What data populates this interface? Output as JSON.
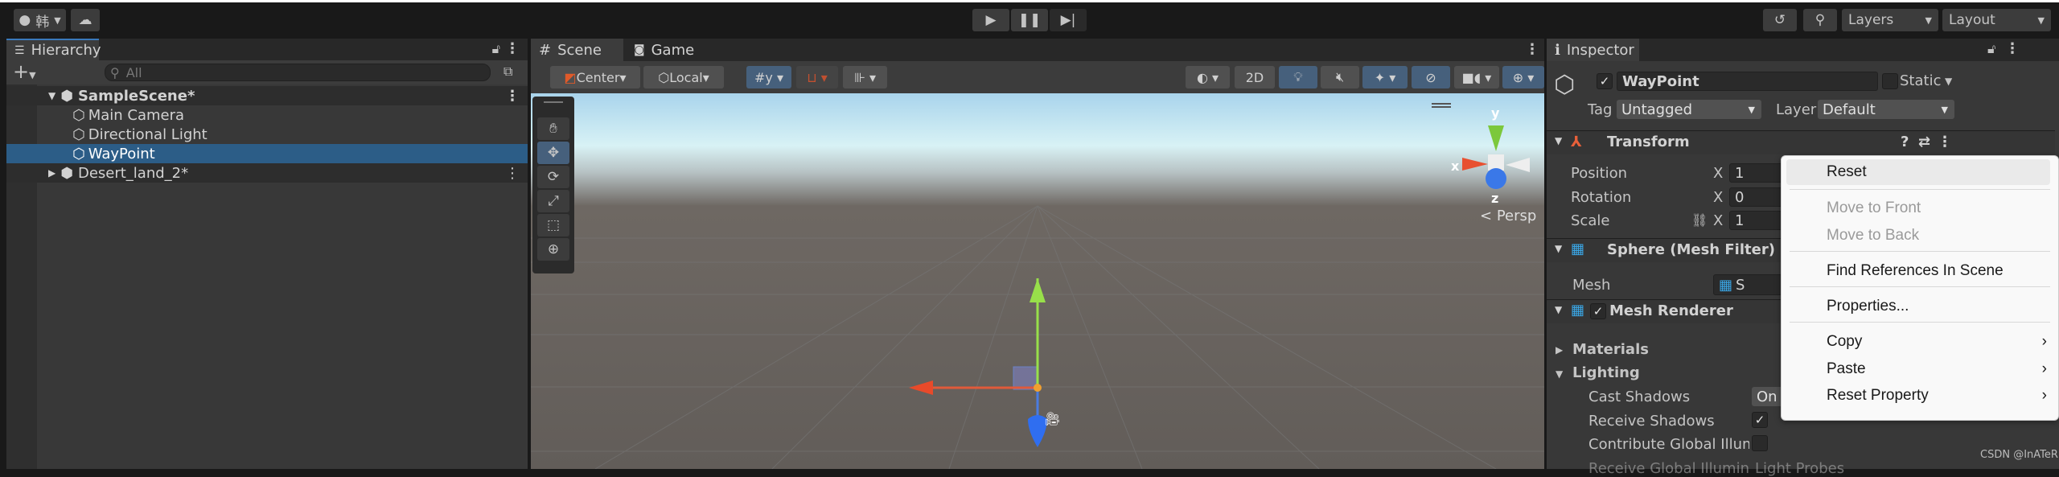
{
  "toolbar": {
    "account_label": "韩",
    "layers": "Layers",
    "layout": "Layout"
  },
  "hierarchy": {
    "tab": "Hierarchy",
    "search_placeholder": "All",
    "items": [
      {
        "label": "SampleScene*"
      },
      {
        "label": "Main Camera"
      },
      {
        "label": "Directional Light"
      },
      {
        "label": "WayPoint"
      },
      {
        "label": "Desert_land_2*"
      }
    ]
  },
  "scene": {
    "tabs": [
      {
        "label": "Scene"
      },
      {
        "label": "Game"
      }
    ],
    "pivot": "Center",
    "space": "Local",
    "mode_2d": "2D",
    "persp": "Persp",
    "gizmo_axes": {
      "x": "x",
      "y": "y",
      "z": "z"
    }
  },
  "inspector": {
    "tab": "Inspector",
    "name": "WayPoint",
    "static": "Static",
    "tag_label": "Tag",
    "tag": "Untagged",
    "layer_label": "Layer",
    "layer": "Default",
    "transform": {
      "title": "Transform",
      "position": "Position",
      "rotation": "Rotation",
      "scale": "Scale",
      "x": "X",
      "pos_x": "1",
      "rot_x": "0",
      "scale_x": "1"
    },
    "mesh_filter": {
      "title": "Sphere (Mesh Filter)",
      "mesh_label": "Mesh",
      "mesh_value": "S"
    },
    "mesh_renderer": {
      "title": "Mesh Renderer",
      "materials": "Materials",
      "lighting": "Lighting",
      "cast_shadows": "Cast Shadows",
      "cast_value": "On",
      "receive_shadows": "Receive Shadows",
      "contribute": "Contribute Global Illum",
      "receive_gi": "Receive Global Illumin",
      "receive_gi_value": "Light Probes"
    }
  },
  "context_menu": {
    "items": [
      {
        "label": "Reset",
        "enabled": true
      },
      {
        "label": "Move to Front",
        "enabled": false
      },
      {
        "label": "Move to Back",
        "enabled": false
      },
      {
        "label": "Find References In Scene",
        "enabled": true
      },
      {
        "label": "Properties...",
        "enabled": true
      },
      {
        "label": "Copy",
        "submenu": true
      },
      {
        "label": "Paste",
        "submenu": true
      },
      {
        "label": "Reset Property",
        "submenu": true
      }
    ]
  },
  "watermark": "CSDN @InATeR"
}
